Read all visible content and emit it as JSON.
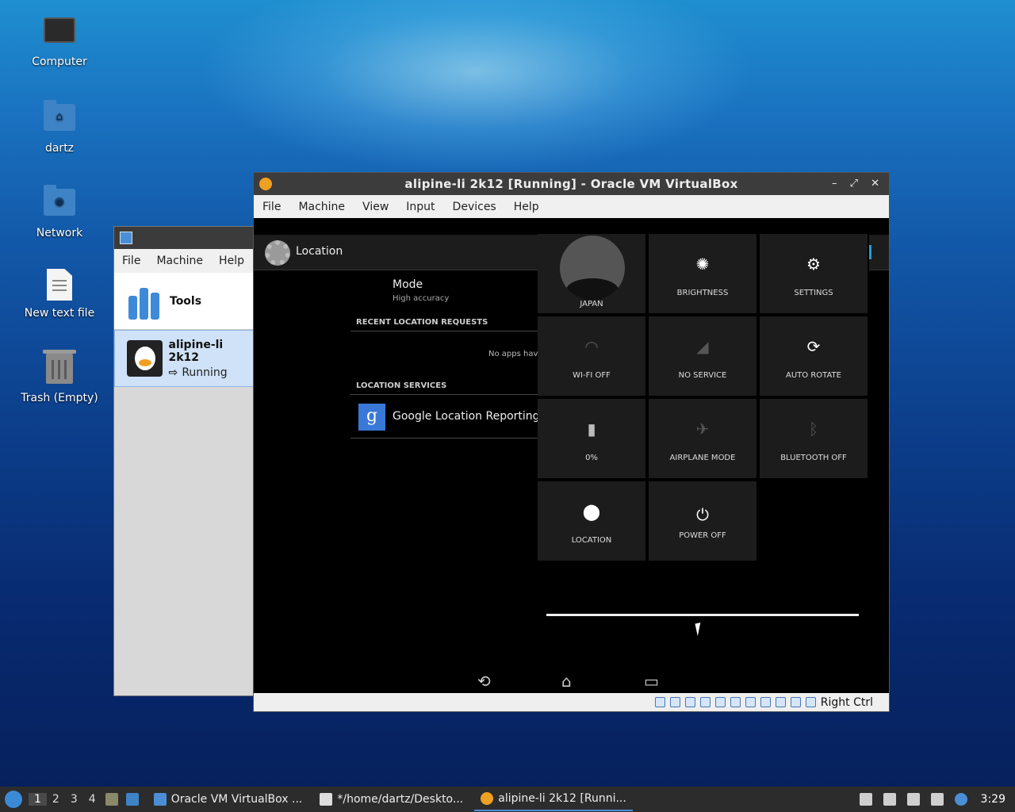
{
  "desktop": {
    "icons": [
      {
        "label": "Computer"
      },
      {
        "label": "dartz"
      },
      {
        "label": "Network"
      },
      {
        "label": "New text file"
      },
      {
        "label": "Trash (Empty)"
      }
    ]
  },
  "manager": {
    "menu": [
      "File",
      "Machine",
      "Help"
    ],
    "tools_label": "Tools",
    "vm_name": "alipine-li 2k12",
    "vm_state": "Running"
  },
  "vbox": {
    "title": "alipine-li 2k12 [Running] - Oracle VM VirtualBox",
    "controls": "– ⤢ ✕",
    "menu": [
      "File",
      "Machine",
      "Input",
      "Devices",
      "Help"
    ],
    "menu_full": [
      "File",
      "Machine",
      "View",
      "Input",
      "Devices",
      "Help"
    ],
    "host_key": "Right Ctrl"
  },
  "android": {
    "header_title": "Location",
    "mode_title": "Mode",
    "mode_value": "High accuracy",
    "recent_header": "RECENT LOCATION REQUESTS",
    "no_apps": "No apps hav",
    "services_header": "LOCATION SERVICES",
    "google_item": "Google Location Reporting",
    "google_glyph": "g",
    "quick_tiles": [
      {
        "label": "JAPAN",
        "icon": "avatar-icon"
      },
      {
        "label": "BRIGHTNESS",
        "icon": "brightness-icon"
      },
      {
        "label": "SETTINGS",
        "icon": "settings-gear-icon"
      },
      {
        "label": "WI-FI OFF",
        "icon": "wifi-icon"
      },
      {
        "label": "NO SERVICE",
        "icon": "signal-icon"
      },
      {
        "label": "AUTO ROTATE",
        "icon": "rotate-icon"
      },
      {
        "label": "0%",
        "icon": "battery-icon"
      },
      {
        "label": "AIRPLANE MODE",
        "icon": "airplane-icon"
      },
      {
        "label": "BLUETOOTH OFF",
        "icon": "bluetooth-icon"
      },
      {
        "label": "LOCATION",
        "icon": "location-pin-icon"
      },
      {
        "label": "POWER OFF",
        "icon": "power-icon"
      }
    ],
    "nav": {
      "back": "⟲",
      "home": "⌂",
      "recents": "▭"
    }
  },
  "taskbar": {
    "workspaces": [
      "1",
      "2",
      "3",
      "4"
    ],
    "tasks": [
      {
        "label": "Oracle VM VirtualBox ..."
      },
      {
        "label": "*/home/dartz/Deskto..."
      },
      {
        "label": "alipine-li 2k12 [Runni..."
      }
    ],
    "clock": "3:29"
  }
}
